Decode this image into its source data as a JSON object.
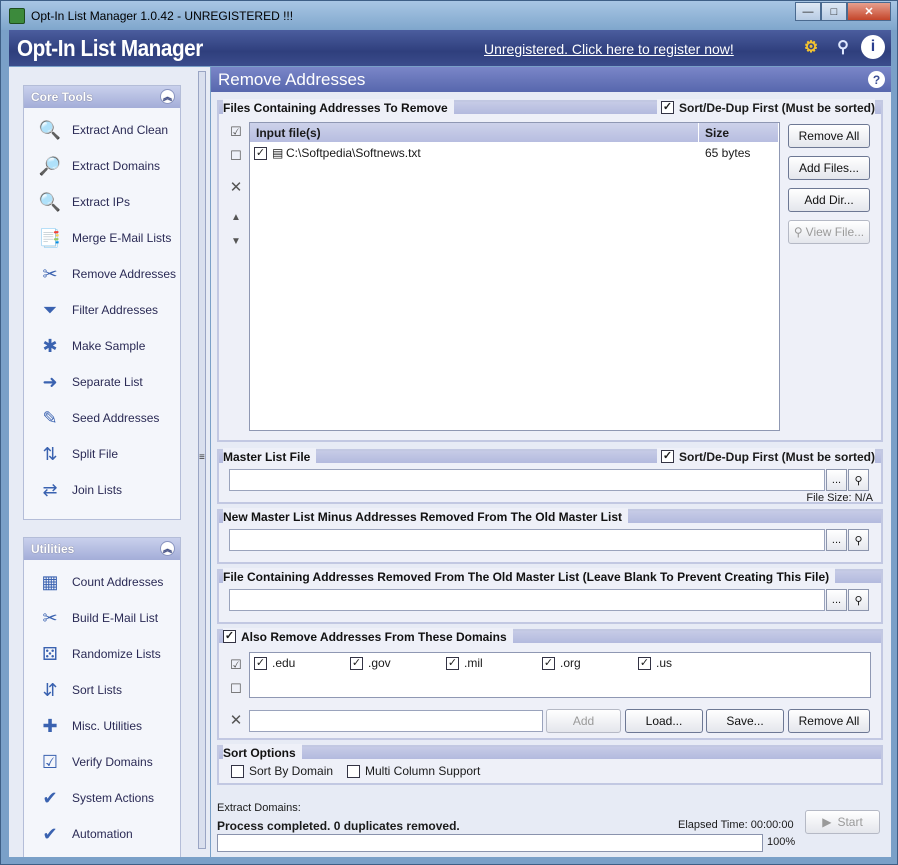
{
  "window": {
    "title": "Opt-In List Manager 1.0.42 - UNREGISTERED !!!",
    "min": "—",
    "max": "□",
    "close": "✕"
  },
  "header": {
    "logo": "Opt-In List Manager",
    "register_link": "Unregistered. Click here to register now!"
  },
  "sidebar": {
    "core_tools": {
      "title": "Core Tools",
      "items": [
        {
          "label": "Extract And Clean",
          "icon": "magnifier-icon"
        },
        {
          "label": "Extract Domains",
          "icon": "domain-magnifier-icon"
        },
        {
          "label": "Extract IPs",
          "icon": "ip-magnifier-icon"
        },
        {
          "label": "Merge E-Mail Lists",
          "icon": "merge-icon"
        },
        {
          "label": "Remove Addresses",
          "icon": "remove-icon"
        },
        {
          "label": "Filter Addresses",
          "icon": "filter-icon"
        },
        {
          "label": "Make Sample",
          "icon": "sample-icon"
        },
        {
          "label": "Separate List",
          "icon": "separate-icon"
        },
        {
          "label": "Seed Addresses",
          "icon": "seed-icon"
        },
        {
          "label": "Split File",
          "icon": "split-icon"
        },
        {
          "label": "Join Lists",
          "icon": "join-icon"
        }
      ]
    },
    "utilities": {
      "title": "Utilities",
      "items": [
        {
          "label": "Count Addresses",
          "icon": "calculator-icon"
        },
        {
          "label": "Build E-Mail List",
          "icon": "knife-icon"
        },
        {
          "label": "Randomize Lists",
          "icon": "dice-icon"
        },
        {
          "label": "Sort Lists",
          "icon": "sort-icon"
        },
        {
          "label": "Misc. Utilities",
          "icon": "toolbox-icon"
        },
        {
          "label": "Verify Domains",
          "icon": "verify-icon"
        },
        {
          "label": "System Actions",
          "icon": "system-icon"
        },
        {
          "label": "Automation",
          "icon": "automation-icon"
        }
      ]
    }
  },
  "main": {
    "title": "Remove Addresses",
    "files_panel": {
      "title": "Files Containing Addresses To Remove",
      "sort_label": "Sort/De-Dup First (Must be sorted)",
      "col_file": "Input file(s)",
      "col_size": "Size",
      "rows": [
        {
          "file": "C:\\Softpedia\\Softnews.txt",
          "size": "65 bytes"
        }
      ],
      "btn_remove_all": "Remove All",
      "btn_add_files": "Add Files...",
      "btn_add_dir": "Add Dir...",
      "btn_view_file": "View File..."
    },
    "master_panel": {
      "title": "Master List File",
      "sort_label": "Sort/De-Dup First (Must be sorted)",
      "value": "",
      "file_size": "File Size: N/A"
    },
    "new_master_panel": {
      "title": "New Master List Minus Addresses Removed From The Old Master List",
      "value": ""
    },
    "removed_panel": {
      "title": "File Containing Addresses Removed From The Old Master List (Leave Blank To Prevent Creating This File)",
      "value": ""
    },
    "domains_panel": {
      "title": "Also Remove Addresses From These Domains",
      "domains": [
        ".edu",
        ".gov",
        ".mil",
        ".org",
        ".us"
      ],
      "input_value": "",
      "btn_add": "Add",
      "btn_load": "Load...",
      "btn_save": "Save...",
      "btn_remove_all": "Remove All"
    },
    "sort_options": {
      "title": "Sort Options",
      "by_domain": "Sort By Domain",
      "multi_column": "Multi Column Support"
    },
    "status": {
      "task": "Extract Domains:",
      "message": "Process completed. 0 duplicates removed.",
      "elapsed_label": "Elapsed Time:",
      "elapsed": "00:00:00",
      "percent": "100%",
      "progress": 1.0,
      "start": "Start"
    }
  }
}
